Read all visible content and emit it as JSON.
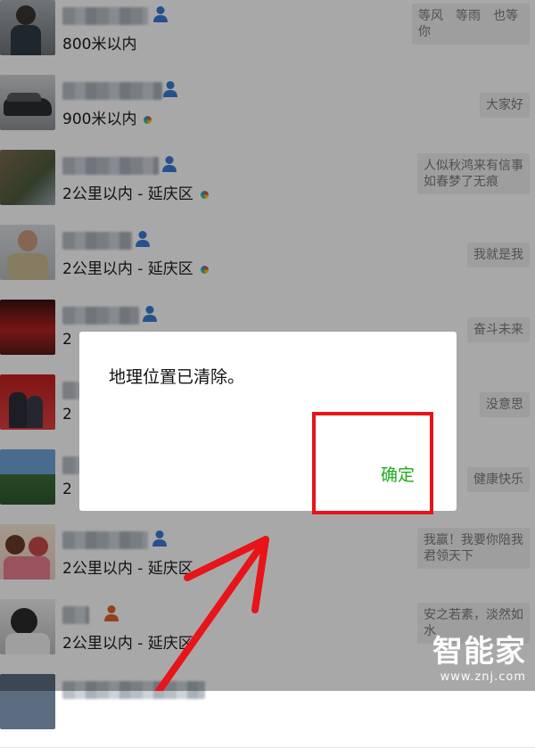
{
  "contacts": [
    {
      "distance": "800米以内",
      "signature": "等风　等雨　也等你",
      "gender": "male",
      "gender_color": "#3a7bd5",
      "dot": false
    },
    {
      "distance": "900米以内",
      "signature": "大家好",
      "gender": "male",
      "gender_color": "#3a7bd5",
      "dot": true
    },
    {
      "distance": "2公里以内 - 延庆区",
      "signature": "人似秋鸿来有信事如春梦了无痕",
      "gender": "male",
      "gender_color": "#3a7bd5",
      "dot": true
    },
    {
      "distance": "2公里以内 - 延庆区",
      "signature": "我就是我",
      "gender": "male",
      "gender_color": "#3a7bd5",
      "dot": true
    },
    {
      "distance": "2",
      "signature": "奋斗未来",
      "gender": "male",
      "gender_color": "#3a7bd5",
      "dot": false
    },
    {
      "distance": "2",
      "signature": "没意思",
      "gender": "male",
      "gender_color": "#3a7bd5",
      "dot": false
    },
    {
      "distance": "2",
      "signature": "健康快乐",
      "gender": "male",
      "gender_color": "#3a7bd5",
      "dot": false
    },
    {
      "distance": "2公里以内 - 延庆区",
      "signature": "我赢！我要你陪我君领天下",
      "gender": "male",
      "gender_color": "#3a7bd5",
      "dot": false
    },
    {
      "distance": "2公里以内 - 延庆区",
      "signature": "安之若素，淡然如水",
      "gender": "female",
      "gender_color": "#e0632a",
      "dot": false
    }
  ],
  "dialog": {
    "message": "地理位置已清除。",
    "ok_label": "确定",
    "ok_color": "#1aad19"
  },
  "annotation": {
    "highlight_color": "#e8141a"
  },
  "watermark": {
    "main": "智能家",
    "sub": "www.znj.com"
  }
}
